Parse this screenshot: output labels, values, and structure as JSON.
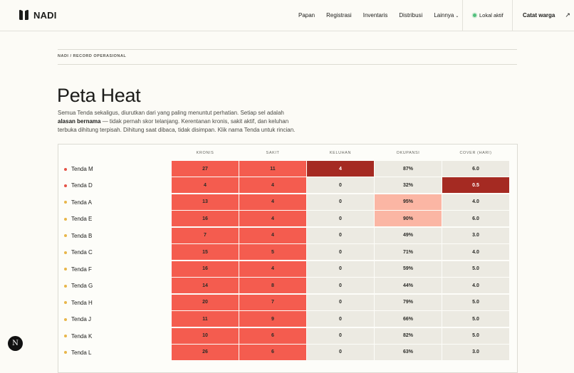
{
  "brand": {
    "name": "NADI"
  },
  "nav": {
    "items": [
      "Papan",
      "Registrasi",
      "Inventaris",
      "Distribusi",
      "Lainnya"
    ],
    "more_chevron": "⌄"
  },
  "status": {
    "label": "Lokal aktif",
    "color": "#52c07d"
  },
  "cta": {
    "label": "Catat warga",
    "arrow": "↗"
  },
  "breadcrumb": "NADI / RECORD OPERASIONAL",
  "page": {
    "title": "Peta Heat",
    "desc_1": "Semua Tenda sekaligus, diurutkan dari yang paling menuntut perhatian. Setiap sel adalah ",
    "desc_bold": "alasan bernama",
    "desc_2": " — tidak pernah skor telanjang. Kerentanan kronis, sakit aktif, dan keluhan terbuka dihitung terpisah. Dihitung saat dibaca, tidak disimpan. Klik nama Tenda untuk rincian."
  },
  "table": {
    "columns": [
      "KRONIS",
      "SAKIT",
      "KELUHAN",
      "OKUPANSI",
      "COVER (HARI)"
    ],
    "rows": [
      {
        "name": "Tenda M",
        "dot": "#e55347",
        "values": [
          "27",
          "11",
          "4",
          "87%",
          "6.0"
        ],
        "levels": [
          "high",
          "high",
          "critical",
          "neutral",
          "neutral"
        ]
      },
      {
        "name": "Tenda D",
        "dot": "#e55347",
        "values": [
          "4",
          "4",
          "0",
          "32%",
          "0.5"
        ],
        "levels": [
          "high",
          "high",
          "neutral",
          "neutral",
          "critical"
        ]
      },
      {
        "name": "Tenda A",
        "dot": "#e8b64a",
        "values": [
          "13",
          "4",
          "0",
          "95%",
          "4.0"
        ],
        "levels": [
          "high",
          "high",
          "neutral",
          "light",
          "neutral"
        ]
      },
      {
        "name": "Tenda E",
        "dot": "#e8b64a",
        "values": [
          "16",
          "4",
          "0",
          "90%",
          "6.0"
        ],
        "levels": [
          "high",
          "high",
          "neutral",
          "light",
          "neutral"
        ]
      },
      {
        "name": "Tenda B",
        "dot": "#e8b64a",
        "values": [
          "7",
          "4",
          "0",
          "49%",
          "3.0"
        ],
        "levels": [
          "high",
          "high",
          "neutral",
          "neutral",
          "neutral"
        ]
      },
      {
        "name": "Tenda C",
        "dot": "#e8b64a",
        "values": [
          "15",
          "5",
          "0",
          "71%",
          "4.0"
        ],
        "levels": [
          "high",
          "high",
          "neutral",
          "neutral",
          "neutral"
        ]
      },
      {
        "name": "Tenda F",
        "dot": "#e8b64a",
        "values": [
          "16",
          "4",
          "0",
          "59%",
          "5.0"
        ],
        "levels": [
          "high",
          "high",
          "neutral",
          "neutral",
          "neutral"
        ]
      },
      {
        "name": "Tenda G",
        "dot": "#e8b64a",
        "values": [
          "14",
          "8",
          "0",
          "44%",
          "4.0"
        ],
        "levels": [
          "high",
          "high",
          "neutral",
          "neutral",
          "neutral"
        ]
      },
      {
        "name": "Tenda H",
        "dot": "#e8b64a",
        "values": [
          "20",
          "7",
          "0",
          "79%",
          "5.0"
        ],
        "levels": [
          "high",
          "high",
          "neutral",
          "neutral",
          "neutral"
        ]
      },
      {
        "name": "Tenda J",
        "dot": "#e8b64a",
        "values": [
          "11",
          "9",
          "0",
          "66%",
          "5.0"
        ],
        "levels": [
          "high",
          "high",
          "neutral",
          "neutral",
          "neutral"
        ]
      },
      {
        "name": "Tenda K",
        "dot": "#e8b64a",
        "values": [
          "10",
          "6",
          "0",
          "82%",
          "5.0"
        ],
        "levels": [
          "high",
          "high",
          "neutral",
          "neutral",
          "neutral"
        ]
      },
      {
        "name": "Tenda L",
        "dot": "#e8b64a",
        "values": [
          "26",
          "6",
          "0",
          "63%",
          "3.0"
        ],
        "levels": [
          "high",
          "high",
          "neutral",
          "neutral",
          "neutral"
        ]
      }
    ]
  },
  "colors": {
    "high": "#f45c4f",
    "critical": "#a52a22",
    "light": "#fbb6a4",
    "neutral": "#eceae2",
    "critical_text": "#ffffff"
  },
  "fab": {
    "glyph": "N"
  }
}
